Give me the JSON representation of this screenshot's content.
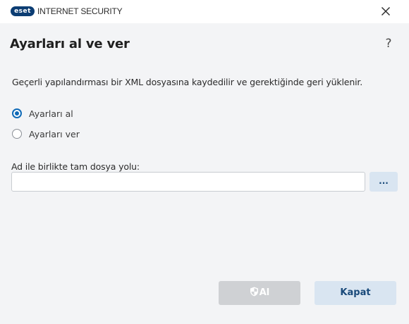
{
  "window": {
    "logo_text": "eset",
    "product_name": "INTERNET SECURITY",
    "close_icon": "close-icon",
    "brand_color": "#0c3d73"
  },
  "dialog": {
    "heading": "Ayarları al ve ver",
    "help_label": "?",
    "description": "Geçerli yapılandırması bir XML dosyasına kaydedilir ve gerektiğinde geri yüklenir."
  },
  "options": {
    "import_label": "Ayarları al",
    "import_selected": true,
    "export_label": "Ayarları ver",
    "export_selected": false,
    "accent_color": "#0f6ab7"
  },
  "path": {
    "label": "Ad ile birlikte tam dosya yolu:",
    "value": "",
    "browse_label": "..."
  },
  "buttons": {
    "primary_label": "Al",
    "primary_icon": "shield-icon",
    "primary_disabled": true,
    "close_label": "Kapat"
  }
}
